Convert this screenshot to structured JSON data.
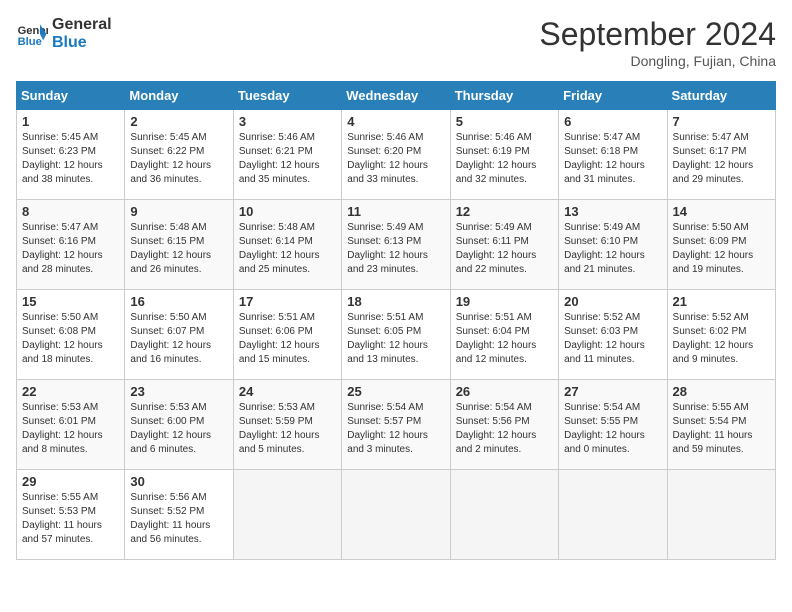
{
  "logo": {
    "line1": "General",
    "line2": "Blue"
  },
  "title": "September 2024",
  "location": "Dongling, Fujian, China",
  "weekdays": [
    "Sunday",
    "Monday",
    "Tuesday",
    "Wednesday",
    "Thursday",
    "Friday",
    "Saturday"
  ],
  "weeks": [
    [
      {
        "day": "1",
        "sunrise": "5:45 AM",
        "sunset": "6:23 PM",
        "daylight": "12 hours and 38 minutes."
      },
      {
        "day": "2",
        "sunrise": "5:45 AM",
        "sunset": "6:22 PM",
        "daylight": "12 hours and 36 minutes."
      },
      {
        "day": "3",
        "sunrise": "5:46 AM",
        "sunset": "6:21 PM",
        "daylight": "12 hours and 35 minutes."
      },
      {
        "day": "4",
        "sunrise": "5:46 AM",
        "sunset": "6:20 PM",
        "daylight": "12 hours and 33 minutes."
      },
      {
        "day": "5",
        "sunrise": "5:46 AM",
        "sunset": "6:19 PM",
        "daylight": "12 hours and 32 minutes."
      },
      {
        "day": "6",
        "sunrise": "5:47 AM",
        "sunset": "6:18 PM",
        "daylight": "12 hours and 31 minutes."
      },
      {
        "day": "7",
        "sunrise": "5:47 AM",
        "sunset": "6:17 PM",
        "daylight": "12 hours and 29 minutes."
      }
    ],
    [
      {
        "day": "8",
        "sunrise": "5:47 AM",
        "sunset": "6:16 PM",
        "daylight": "12 hours and 28 minutes."
      },
      {
        "day": "9",
        "sunrise": "5:48 AM",
        "sunset": "6:15 PM",
        "daylight": "12 hours and 26 minutes."
      },
      {
        "day": "10",
        "sunrise": "5:48 AM",
        "sunset": "6:14 PM",
        "daylight": "12 hours and 25 minutes."
      },
      {
        "day": "11",
        "sunrise": "5:49 AM",
        "sunset": "6:13 PM",
        "daylight": "12 hours and 23 minutes."
      },
      {
        "day": "12",
        "sunrise": "5:49 AM",
        "sunset": "6:11 PM",
        "daylight": "12 hours and 22 minutes."
      },
      {
        "day": "13",
        "sunrise": "5:49 AM",
        "sunset": "6:10 PM",
        "daylight": "12 hours and 21 minutes."
      },
      {
        "day": "14",
        "sunrise": "5:50 AM",
        "sunset": "6:09 PM",
        "daylight": "12 hours and 19 minutes."
      }
    ],
    [
      {
        "day": "15",
        "sunrise": "5:50 AM",
        "sunset": "6:08 PM",
        "daylight": "12 hours and 18 minutes."
      },
      {
        "day": "16",
        "sunrise": "5:50 AM",
        "sunset": "6:07 PM",
        "daylight": "12 hours and 16 minutes."
      },
      {
        "day": "17",
        "sunrise": "5:51 AM",
        "sunset": "6:06 PM",
        "daylight": "12 hours and 15 minutes."
      },
      {
        "day": "18",
        "sunrise": "5:51 AM",
        "sunset": "6:05 PM",
        "daylight": "12 hours and 13 minutes."
      },
      {
        "day": "19",
        "sunrise": "5:51 AM",
        "sunset": "6:04 PM",
        "daylight": "12 hours and 12 minutes."
      },
      {
        "day": "20",
        "sunrise": "5:52 AM",
        "sunset": "6:03 PM",
        "daylight": "12 hours and 11 minutes."
      },
      {
        "day": "21",
        "sunrise": "5:52 AM",
        "sunset": "6:02 PM",
        "daylight": "12 hours and 9 minutes."
      }
    ],
    [
      {
        "day": "22",
        "sunrise": "5:53 AM",
        "sunset": "6:01 PM",
        "daylight": "12 hours and 8 minutes."
      },
      {
        "day": "23",
        "sunrise": "5:53 AM",
        "sunset": "6:00 PM",
        "daylight": "12 hours and 6 minutes."
      },
      {
        "day": "24",
        "sunrise": "5:53 AM",
        "sunset": "5:59 PM",
        "daylight": "12 hours and 5 minutes."
      },
      {
        "day": "25",
        "sunrise": "5:54 AM",
        "sunset": "5:57 PM",
        "daylight": "12 hours and 3 minutes."
      },
      {
        "day": "26",
        "sunrise": "5:54 AM",
        "sunset": "5:56 PM",
        "daylight": "12 hours and 2 minutes."
      },
      {
        "day": "27",
        "sunrise": "5:54 AM",
        "sunset": "5:55 PM",
        "daylight": "12 hours and 0 minutes."
      },
      {
        "day": "28",
        "sunrise": "5:55 AM",
        "sunset": "5:54 PM",
        "daylight": "11 hours and 59 minutes."
      }
    ],
    [
      {
        "day": "29",
        "sunrise": "5:55 AM",
        "sunset": "5:53 PM",
        "daylight": "11 hours and 57 minutes."
      },
      {
        "day": "30",
        "sunrise": "5:56 AM",
        "sunset": "5:52 PM",
        "daylight": "11 hours and 56 minutes."
      },
      null,
      null,
      null,
      null,
      null
    ]
  ]
}
